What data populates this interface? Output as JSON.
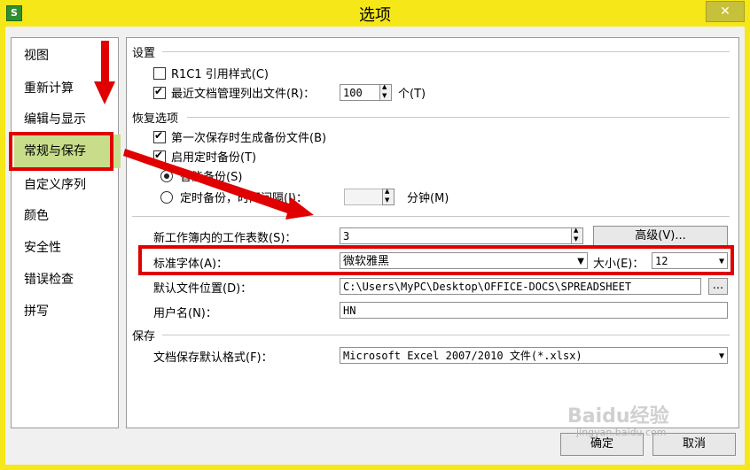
{
  "window": {
    "title": "选项",
    "close_label": "✕",
    "app_icon": "S"
  },
  "sidebar": {
    "items": [
      {
        "label": "视图"
      },
      {
        "label": "重新计算"
      },
      {
        "label": "编辑与显示"
      },
      {
        "label": "常规与保存",
        "selected": true
      },
      {
        "label": "自定义序列"
      },
      {
        "label": "颜色"
      },
      {
        "label": "安全性"
      },
      {
        "label": "错误检查"
      },
      {
        "label": "拼写"
      }
    ]
  },
  "settings": {
    "header": "设置",
    "r1c1_label": "R1C1 引用样式(C)",
    "r1c1_checked": false,
    "recent_label": "最近文档管理列出文件(R)：",
    "recent_checked": true,
    "recent_value": "100",
    "recent_unit": "个(T)"
  },
  "recovery": {
    "header": "恢复选项",
    "backup_first_label": "第一次保存时生成备份文件(B)",
    "backup_first_checked": true,
    "timed_backup_label": "启用定时备份(T)",
    "timed_backup_checked": true,
    "smart_backup_label": "智能备份(S)",
    "smart_backup_selected": true,
    "interval_label": "定时备份，时间间隔(I)：",
    "interval_value": "",
    "interval_unit": "分钟(M)"
  },
  "workbook": {
    "sheets_label": "新工作簿内的工作表数(S)：",
    "sheets_value": "3",
    "advanced_label": "高级(V)...",
    "font_label": "标准字体(A)：",
    "font_value": "微软雅黑",
    "size_label": "大小(E)：",
    "size_value": "12",
    "path_label": "默认文件位置(D)：",
    "path_value": "C:\\Users\\MyPC\\Desktop\\OFFICE-DOCS\\SPREADSHEET",
    "browse_label": "...",
    "user_label": "用户名(N)：",
    "user_value": "HN"
  },
  "save": {
    "header": "保存",
    "format_label": "文档保存默认格式(F)：",
    "format_value": "Microsoft Excel 2007/2010 文件(*.xlsx)"
  },
  "footer": {
    "ok_label": "确定",
    "cancel_label": "取消"
  },
  "watermark": {
    "text": "Baidu经验",
    "url": "jingyan.baidu.com"
  },
  "colors": {
    "title_bar": "#f5e718",
    "highlight": "#e00000",
    "selected_item": "#c7dd8a"
  }
}
